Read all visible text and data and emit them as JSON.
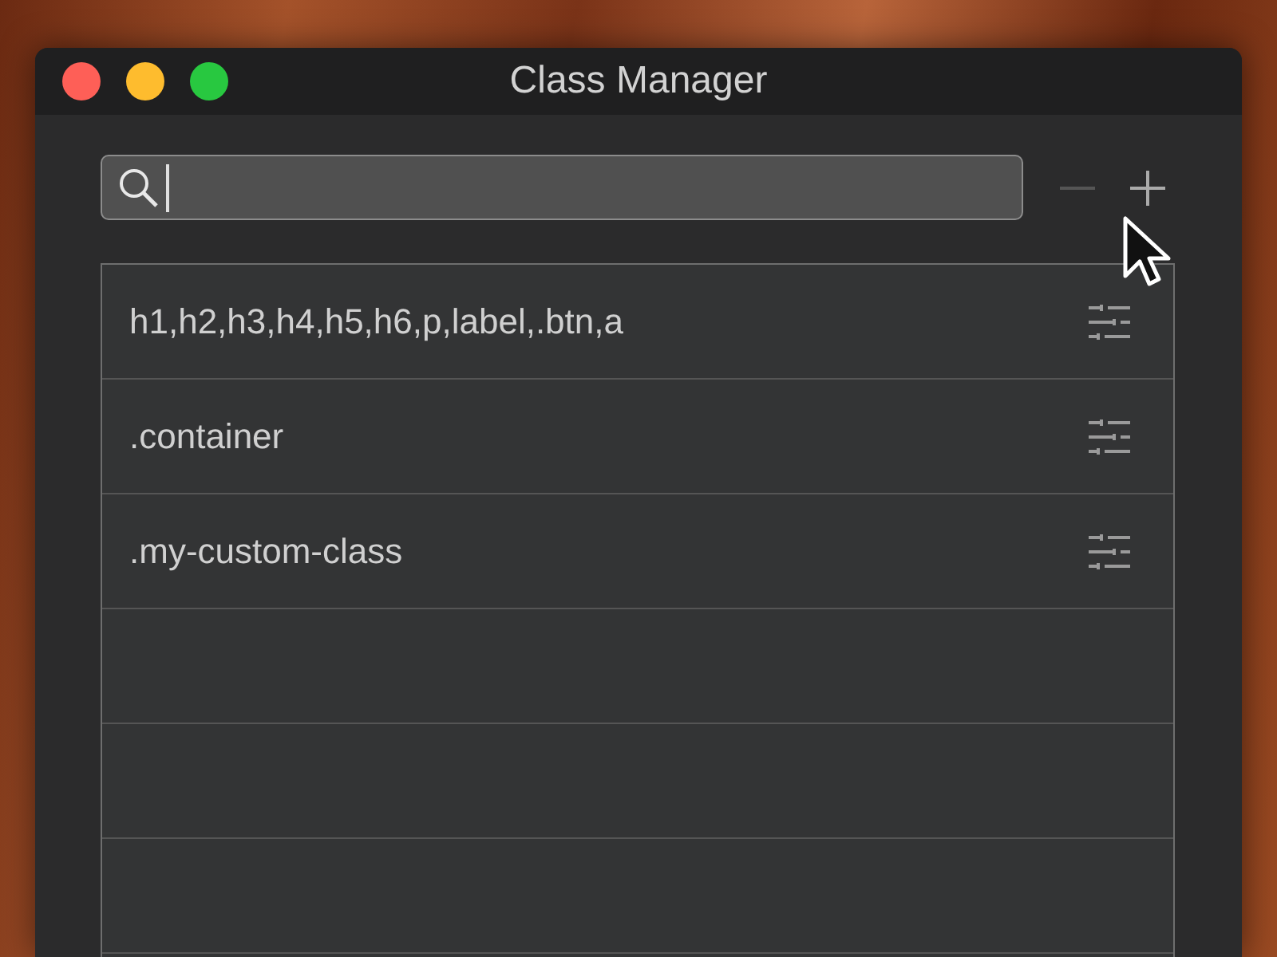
{
  "window": {
    "title": "Class Manager"
  },
  "search": {
    "focused": true
  },
  "toolbar_buttons": [
    {
      "kind": "remove",
      "disabled": true
    },
    {
      "kind": "add",
      "disabled": false
    }
  ],
  "classes": [
    {
      "name": "h1,h2,h3,h4,h5,h6,p,label,.btn,a"
    },
    {
      "name": ".container"
    },
    {
      "name": ".my-custom-class"
    }
  ]
}
